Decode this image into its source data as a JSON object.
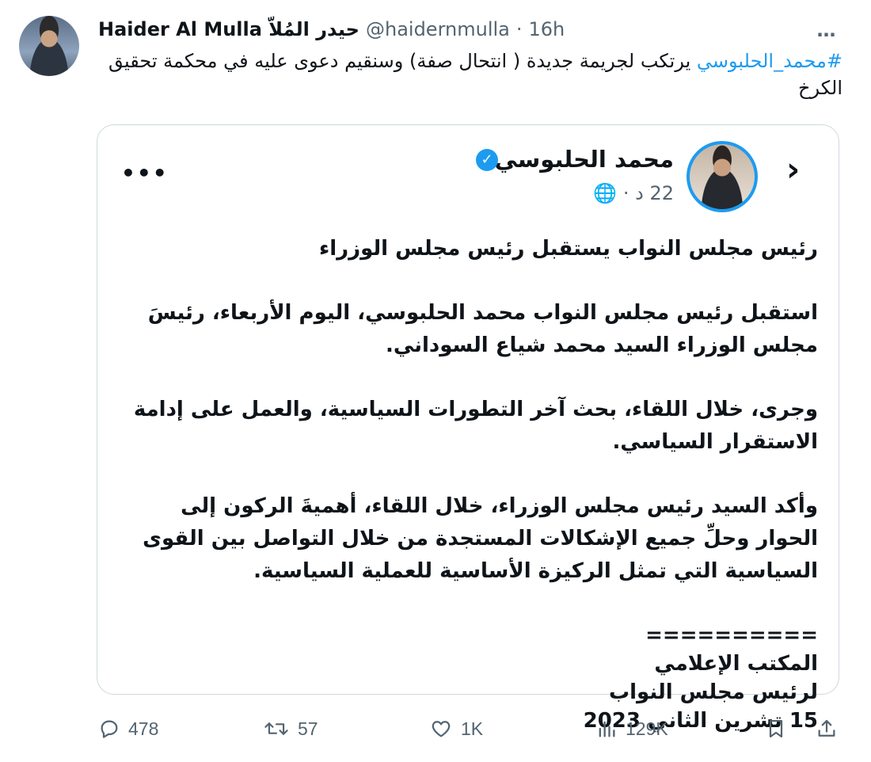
{
  "tweet": {
    "display_name": "Haider Al Mulla حيدر المُلاّ",
    "handle": "@haidernmulla",
    "separator": "·",
    "time": "16h",
    "more": "…",
    "hashtag": "#محمد_الحلبوسي",
    "text": " يرتكب لجريمة جديدة ( انتحال صفة) وسنقيم دعوى عليه في محكمة تحقيق الكرخ"
  },
  "card": {
    "author": "محمد الحلبوسي",
    "meta": "22 د · 🌐",
    "more": "•••",
    "arrow": "›",
    "verified": "✓",
    "headline": "رئيس مجلس النواب يستقبل رئيس مجلس الوزراء",
    "para1": "استقبل رئيس مجلس النواب محمد الحلبوسي، اليوم الأربعاء، رئيسَ مجلس الوزراء السيد محمد شياع السوداني.",
    "para2": "وجرى، خلال اللقاء، بحث آخر التطورات السياسية، والعمل على إدامة الاستقرار السياسي.",
    "para3": "وأكد السيد رئيس مجلس الوزراء، خلال اللقاء، أهميةَ الركون إلى الحوار وحلِّ جميع الإشكالات المستجدة من خلال التواصل بين القوى السياسية التي تمثل الركيزة الأساسية للعملية السياسية.",
    "sig_divider": "==========",
    "sig_office": "المكتب الإعلامي",
    "sig_title": "لرئيس مجلس النواب",
    "sig_date": "15 تشرين الثاني 2023"
  },
  "actions": {
    "replies": "478",
    "reposts": "57",
    "likes": "1K",
    "views": "129K"
  },
  "icons": {
    "reply": "reply-icon",
    "repost": "repost-icon",
    "like": "heart-icon",
    "views": "views-icon",
    "bookmark": "bookmark-icon",
    "share": "share-icon"
  },
  "colors": {
    "accent": "#1d9bf0",
    "muted": "#536471",
    "text": "#0f1419",
    "border": "#cfd9de"
  }
}
